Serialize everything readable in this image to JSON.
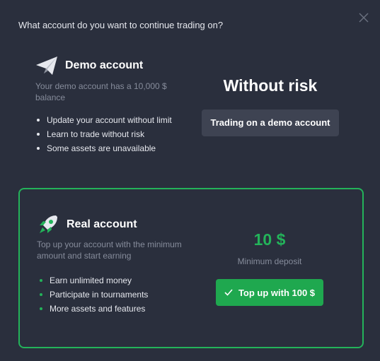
{
  "dialog": {
    "question": "What account do you want to continue trading on?",
    "close_icon": "close-icon"
  },
  "demo": {
    "icon": "paper-plane-icon",
    "title": "Demo account",
    "description": "Your demo account has a 10,000 $ balance",
    "features": [
      "Update your account without limit",
      "Learn to trade without risk",
      "Some assets are unavailable"
    ],
    "headline": "Without risk",
    "button_label": "Trading on a demo account"
  },
  "real": {
    "icon": "rocket-icon",
    "title": "Real account",
    "description": "Top up your account with the minimum amount and start earning",
    "features": [
      "Earn unlimited money",
      "Participate in tournaments",
      "More assets and features"
    ],
    "min_amount": "10 $",
    "min_label": "Minimum deposit",
    "button_icon": "check-icon",
    "button_label": "Top up with 100 $"
  },
  "colors": {
    "background": "#2a2f3d",
    "accent_green": "#23b35a",
    "button_gray": "#3e4352",
    "muted_text": "#868c9b"
  }
}
